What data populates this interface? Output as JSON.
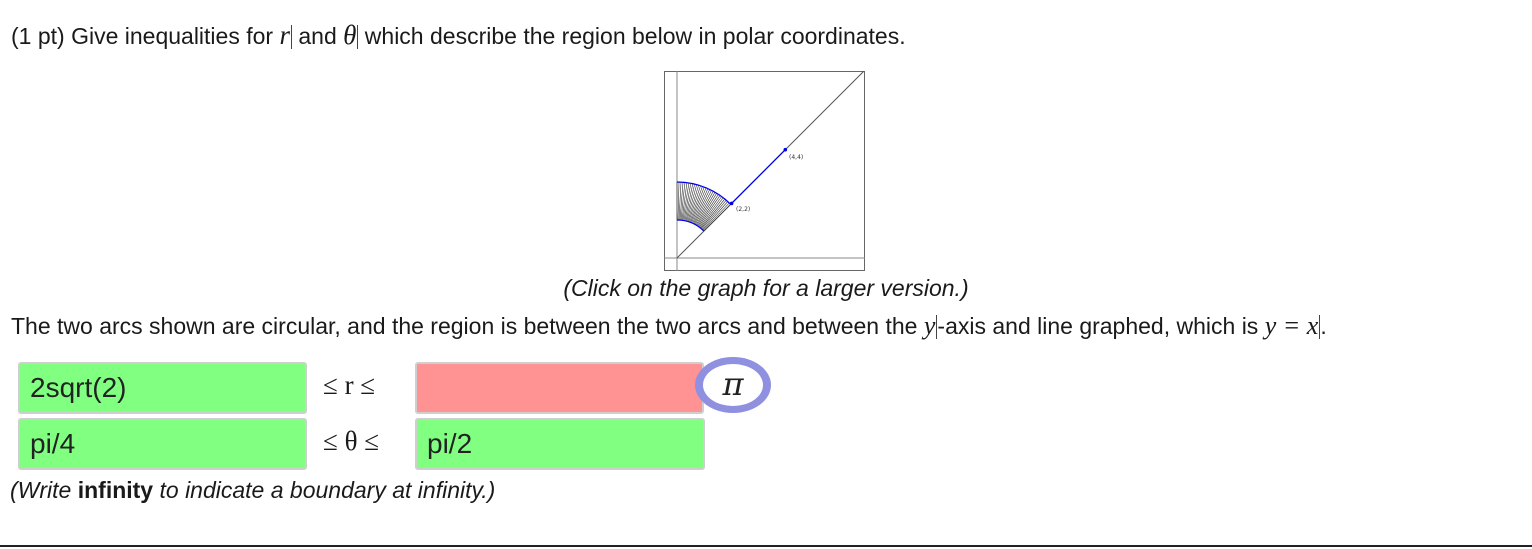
{
  "question": {
    "points": "(1 pt)",
    "text_before": "Give inequalities for",
    "var_r": "r",
    "text_and": "and",
    "var_theta": "θ",
    "text_after": "which describe the region below in polar coordinates."
  },
  "graph": {
    "label_outer_point": "(4,4)",
    "label_inner_point": "(2,2)",
    "caption": "(Click on the graph for a larger version.)"
  },
  "description": {
    "text_1": "The two arcs shown are circular, and the region is between the two arcs and between the",
    "var_y": "y",
    "text_2": "-axis and line graphed, which is",
    "equation": "y = x",
    "text_3": "."
  },
  "answers": {
    "r_lower": {
      "value": "2sqrt(2)",
      "status": "correct"
    },
    "r_upper": {
      "value": "",
      "status": "incorrect"
    },
    "theta_lower": {
      "value": "pi/4",
      "status": "correct"
    },
    "theta_upper": {
      "value": "pi/2",
      "status": "correct"
    }
  },
  "inequalities": {
    "r_middle": "≤ r ≤",
    "theta_middle": "≤ θ ≤"
  },
  "pi_button": {
    "symbol": "π"
  },
  "hint": {
    "before": "(Write",
    "bold": "infinity",
    "after": "to indicate a boundary at infinity.)"
  },
  "colors": {
    "correct_bg": "#80ff80",
    "incorrect_bg": "#ff9393",
    "pi_ring": "#9090e0",
    "region_boundary": "#0000ee"
  }
}
